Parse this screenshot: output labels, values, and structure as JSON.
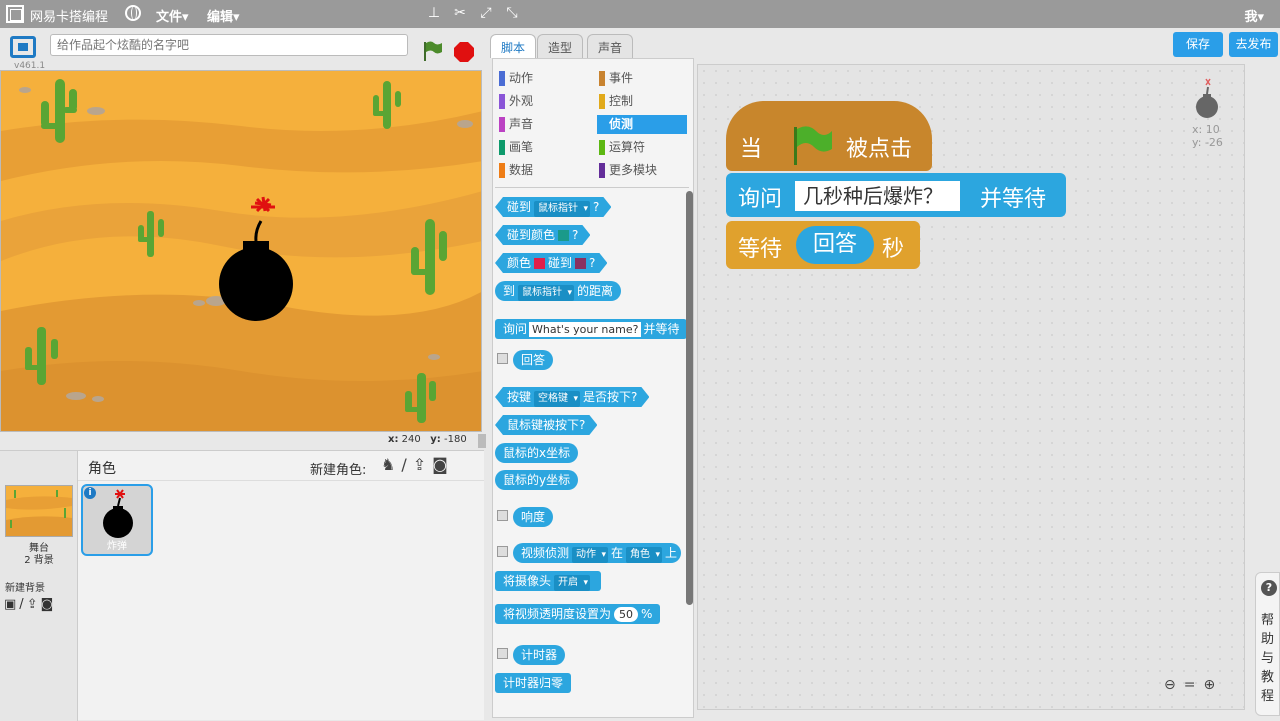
{
  "topbar": {
    "brand": "网易卡搭编程",
    "menu_file": "文件▾",
    "menu_edit": "编辑▾",
    "user": "我▾"
  },
  "stage": {
    "version": "v461.1",
    "title_placeholder": "给作品起个炫酷的名字吧",
    "x_label": "x:",
    "x_value": "240",
    "y_label": "y:",
    "y_value": "-180",
    "background_color": "#f5b03c"
  },
  "sprites": {
    "header": "角色",
    "new_sprite": "新建角色:",
    "stage_label": "舞台",
    "stage_backdrops": "2 背景",
    "new_backdrop": "新建背景",
    "selected_sprite": "炸弹"
  },
  "editor": {
    "tabs": [
      "脚本",
      "造型",
      "声音"
    ],
    "save": "保存",
    "publish": "去发布",
    "help": "帮助与教程",
    "categories": [
      {
        "label": "动作",
        "color": "#4a6cd4"
      },
      {
        "label": "外观",
        "color": "#8a55d7"
      },
      {
        "label": "声音",
        "color": "#bb42c3"
      },
      {
        "label": "画笔",
        "color": "#0e9a6c"
      },
      {
        "label": "数据",
        "color": "#ee7d16"
      },
      {
        "label": "事件",
        "color": "#c88330"
      },
      {
        "label": "控制",
        "color": "#e1a91a"
      },
      {
        "label": "侦测",
        "color": "#2ca5e2"
      },
      {
        "label": "运算符",
        "color": "#5cb712"
      },
      {
        "label": "更多模块",
        "color": "#632d99"
      }
    ],
    "palette": {
      "touching": "碰到",
      "mouse_pointer": "鼠标指针",
      "q": "?",
      "touching_color": "碰到颜色",
      "color_word": "颜色",
      "distance_to": "到",
      "distance_suffix": "的距离",
      "ask": "询问",
      "ask_default": "What's your name?",
      "and_wait": "并等待",
      "answer": "回答",
      "key": "按键",
      "space_key": "空格键",
      "key_pressed": "是否按下?",
      "mouse_down": "鼠标键被按下?",
      "mouse_x": "鼠标的x坐标",
      "mouse_y": "鼠标的y坐标",
      "loudness": "响度",
      "video_detect": "视频侦测",
      "motion": "动作",
      "on": "在",
      "sprite": "角色",
      "on_suffix": "上",
      "turn_camera": "将摄像头",
      "camera_on": "开启",
      "set_transparency": "将视频透明度设置为",
      "transparency": "50",
      "percent": "%",
      "timer": "计时器",
      "reset_timer": "计时器归零"
    },
    "script": {
      "when": "当",
      "clicked": "被点击",
      "ask": "询问",
      "ask_text": "几秒种后爆炸？",
      "and_wait": "并等待",
      "wait": "等待",
      "answer": "回答",
      "seconds": "秒"
    },
    "sprite_x": "x: 10",
    "sprite_y": "y: -26"
  }
}
